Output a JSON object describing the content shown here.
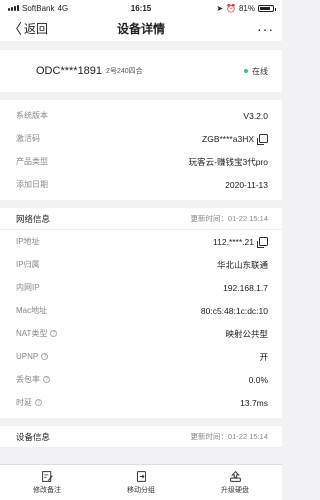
{
  "status_bar": {
    "carrier": "SoftBank",
    "network": "4G",
    "time": "16:15",
    "battery": "81%",
    "battery_level": 0.81
  },
  "nav": {
    "back_label": "返回",
    "title": "设备详情",
    "more_label": "···"
  },
  "device": {
    "name": "ODC****1891",
    "model": "2号240四合",
    "status": "在线",
    "status_color": "#2ec4a6"
  },
  "basic_info": [
    {
      "label": "系统版本",
      "value": "V3.2.0"
    },
    {
      "label": "激活码",
      "value": "ZGB****a3HX",
      "copyable": true
    },
    {
      "label": "产品类型",
      "value": "玩客云-赚钱宝3代pro"
    },
    {
      "label": "添加日期",
      "value": "2020-11-13"
    }
  ],
  "network": {
    "title": "网络信息",
    "update_time": "更新时间：01-22 15:14",
    "rows": [
      {
        "label": "IP地址",
        "value": "112.****.21",
        "copyable": true
      },
      {
        "label": "IP归属",
        "value": "华北山东联通"
      },
      {
        "label": "内网IP",
        "value": "192.168.1.7"
      },
      {
        "label": "Mac地址",
        "value": "80:c5:48:1c:dc:10"
      },
      {
        "label": "NAT类型",
        "value": "映射公共型",
        "help": true
      },
      {
        "label": "UPNP",
        "value": "开",
        "help": true
      },
      {
        "label": "丢包率",
        "value": "0.0%",
        "help": true
      },
      {
        "label": "时延",
        "value": "13.7ms",
        "help": true
      }
    ]
  },
  "device_section": {
    "title": "设备信息",
    "update_time": "更新时间：01-22 15:14"
  },
  "tabs": [
    {
      "label": "修改备注",
      "icon": "edit-note-icon"
    },
    {
      "label": "移动分组",
      "icon": "move-group-icon"
    },
    {
      "label": "升级硬盘",
      "icon": "upgrade-disk-icon"
    }
  ]
}
